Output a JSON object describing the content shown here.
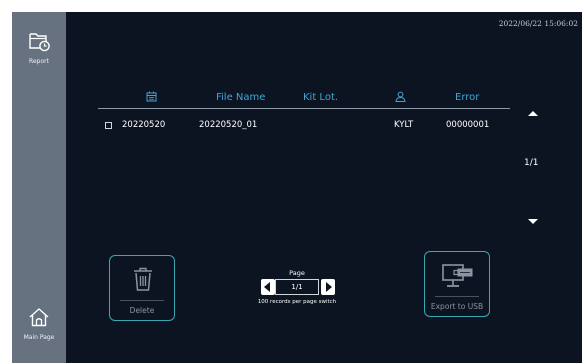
{
  "timestamp": "2022/06/22 15:06:02",
  "sidebar": {
    "report_label": "Report",
    "main_page_label": "Main Page"
  },
  "table": {
    "headers": {
      "date_icon": "calendar-icon",
      "file_name": "File Name",
      "kit_lot": "Kit Lot.",
      "user_icon": "user-icon",
      "error": "Error"
    },
    "rows": [
      {
        "date": "20220520",
        "file_name": "20220520_01",
        "kit_lot": "",
        "user": "KYLT",
        "error": "00000001",
        "checked": false
      }
    ]
  },
  "paging": {
    "indicator": "1/1",
    "title": "Page",
    "value": "1/1",
    "note": "100 records per page switch"
  },
  "buttons": {
    "delete_label": "Delete",
    "export_label": "Export to USB"
  },
  "colors": {
    "background": "#0c1422",
    "sidebar": "#667280",
    "header_text": "#3ea6d8",
    "button_border": "#3aa8b0"
  }
}
